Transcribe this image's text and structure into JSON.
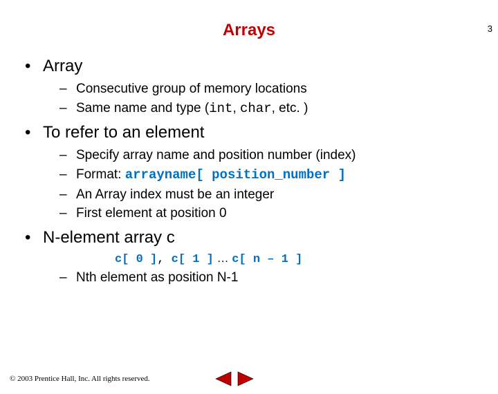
{
  "page_number": "3",
  "title": "Arrays",
  "sections": [
    {
      "heading": "Array",
      "items": [
        {
          "text": "Consecutive group of memory locations"
        },
        {
          "pre": "Same name and type (",
          "code1": "int",
          "mid": ", ",
          "code2": "char",
          "post": ", etc. )"
        }
      ]
    },
    {
      "heading": "To refer to an element",
      "items": [
        {
          "text": "Specify array name and position number (index)"
        },
        {
          "pre": "Format: ",
          "codeblue": "arrayname[ position_number ]"
        },
        {
          "text": "An Array index must be an integer"
        },
        {
          "text": "First element at position 0"
        }
      ]
    },
    {
      "heading": "N-element array c",
      "code_line": {
        "a": "c[ 0 ]",
        "c1": ", ",
        "b": "c[ 1 ]",
        "dots": " … ",
        "c": "c[ n – 1 ]"
      },
      "items": [
        {
          "text": "Nth element as position N-1"
        }
      ]
    }
  ],
  "footer": "© 2003 Prentice Hall, Inc. All rights reserved.",
  "icons": {
    "prev": "prev-triangle",
    "next": "next-triangle"
  }
}
